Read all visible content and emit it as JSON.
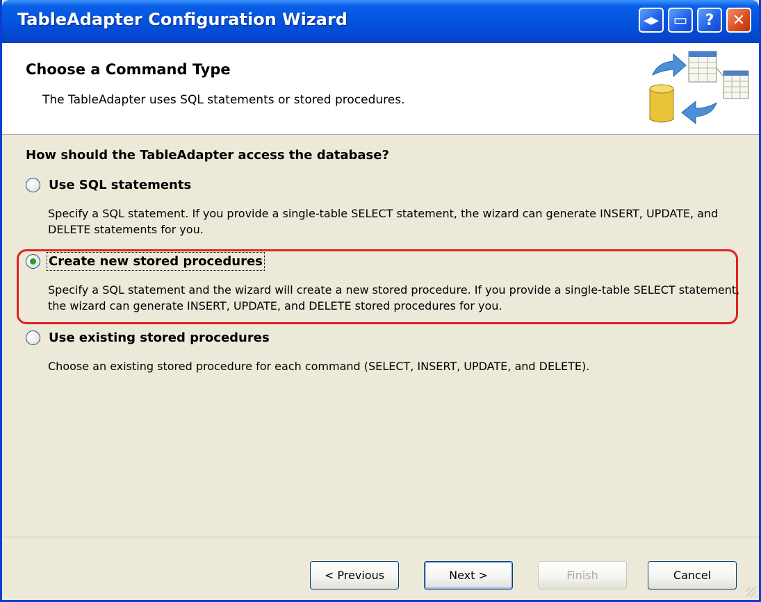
{
  "window": {
    "title": "TableAdapter Configuration Wizard",
    "controls": {
      "expand_icon": "◂▸",
      "restore_icon": "▭",
      "help_icon": "?",
      "close_icon": "✕"
    }
  },
  "header": {
    "title": "Choose a Command Type",
    "subtitle": "The TableAdapter uses SQL statements or stored procedures."
  },
  "main": {
    "question": "How should the TableAdapter access the database?",
    "options": [
      {
        "label": "Use SQL statements",
        "selected": false,
        "description": "Specify a SQL statement. If you provide a single-table SELECT statement, the wizard can generate INSERT, UPDATE, and DELETE statements for you."
      },
      {
        "label": "Create new stored procedures",
        "selected": true,
        "description": "Specify a SQL statement and the wizard will create a new stored procedure. If you provide a single-table SELECT statement, the wizard can generate INSERT, UPDATE, and DELETE stored procedures for you."
      },
      {
        "label": "Use existing stored procedures",
        "selected": false,
        "description": "Choose an existing stored procedure for each command (SELECT, INSERT, UPDATE, and DELETE)."
      }
    ]
  },
  "footer": {
    "previous": "< Previous",
    "next": "Next >",
    "finish": "Finish",
    "cancel": "Cancel"
  },
  "colors": {
    "titlebar": "#0455e0",
    "highlight": "#e02020",
    "radio_selected": "#21a121",
    "background": "#ece9d8"
  }
}
